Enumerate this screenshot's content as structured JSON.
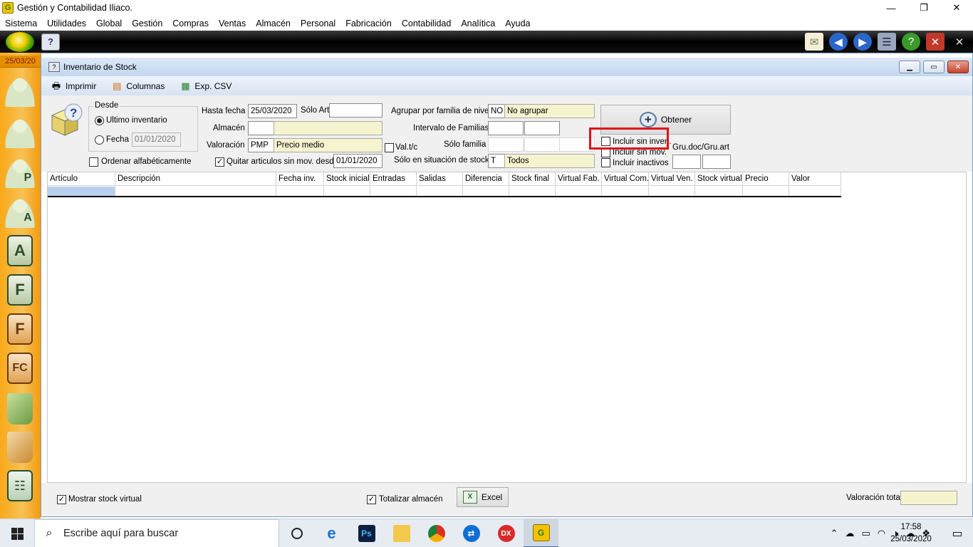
{
  "app": {
    "title": "Gestión y Contabilidad Iliaco.",
    "icon_letter": "G",
    "window_controls": {
      "minimize": "—",
      "restore": "❐",
      "close": "✕"
    }
  },
  "menu": [
    "Sistema",
    "Utilidades",
    "Global",
    "Gestión",
    "Compras",
    "Ventas",
    "Almacén",
    "Personal",
    "Fabricación",
    "Contabilidad",
    "Analítica",
    "Ayuda"
  ],
  "toolbar_right_icons": [
    "mail-icon",
    "back-arrow-icon",
    "forward-arrow-icon",
    "windows-list-icon",
    "help-icon",
    "close-window-icon",
    "close-all-icon"
  ],
  "sidebar": {
    "date": "25/03/20",
    "buttons": [
      {
        "name": "users-group-icon",
        "label": ""
      },
      {
        "name": "user-icon",
        "label": ""
      },
      {
        "name": "user-p-icon",
        "label": "P"
      },
      {
        "name": "user-a-icon",
        "label": "A"
      },
      {
        "name": "letter-a-icon",
        "label": "A"
      },
      {
        "name": "letter-f-icon",
        "label": "F"
      },
      {
        "name": "letter-f-orange-icon",
        "label": "F"
      },
      {
        "name": "letter-fc-icon",
        "label": "FC"
      },
      {
        "name": "green-bag-icon",
        "label": ""
      },
      {
        "name": "orange-bag-icon",
        "label": ""
      },
      {
        "name": "notebook-icon",
        "label": ""
      }
    ]
  },
  "window": {
    "title": "Inventario de Stock",
    "toolbar": {
      "print": "Imprimir",
      "columns": "Columnas",
      "csv": "Exp. CSV"
    }
  },
  "form": {
    "desde_group": "Desde",
    "ultimo_inventario": "Ultimo inventario",
    "fecha_label": "Fecha",
    "fecha_value": "01/01/2020",
    "ordenar": "Ordenar alfabéticamente",
    "hasta_fecha_label": "Hasta fecha",
    "hasta_fecha_value": "25/03/2020",
    "solo_art_label": "Sólo Art.",
    "solo_art_value": "",
    "almacen_label": "Almacén",
    "almacen_code": "",
    "almacen_name": "",
    "valoracion_label": "Valoración",
    "valoracion_code": "PMP",
    "valoracion_name": "Precio medio",
    "quitar_label": "Quitar articulos sin mov. desde",
    "quitar_value": "01/01/2020",
    "valtc_label": "Val.t/c",
    "agrupar_label": "Agrupar por familia de nivel",
    "agrupar_code": "NO",
    "agrupar_name": "No agrupar",
    "intervalo_label": "Intervalo de Familias",
    "solo_familia_label": "Sólo familia",
    "situacion_label": "Sólo en situación de stock",
    "situacion_code": "T",
    "situacion_name": "Todos",
    "obtener": "Obtener",
    "incluir_sin_inven": "Incluir sin inven.",
    "incluir_sin_mov": "Incluir sin mov.",
    "incluir_inactivos": "Incluir inactivos",
    "gru_label": "Gru.doc/Gru.art"
  },
  "grid": {
    "columns": [
      "Artículo",
      "Descripción",
      "Fecha inv.",
      "Stock inicial",
      "Entradas",
      "Salidas",
      "Diferencia",
      "Stock final",
      "Virtual Fab.",
      "Virtual Com.",
      "Virtual Ven.",
      "Stock virtual",
      "Precio",
      "Valor"
    ]
  },
  "bottom": {
    "mostrar_stock_virtual": "Mostrar stock virtual",
    "totalizar_almacen": "Totalizar almacén",
    "excel": "Excel",
    "valoracion_total_label": "Valoración total",
    "valoracion_total_value": ""
  },
  "taskbar": {
    "search_placeholder": "Escribe aquí para buscar",
    "apps": [
      "cortana-icon",
      "edge-icon",
      "photoshop-icon",
      "file-explorer-icon",
      "chrome-icon",
      "teamviewer-icon",
      "dx-icon",
      "gestion-app-icon"
    ],
    "time": "17:58",
    "date": "25/03/2020"
  }
}
